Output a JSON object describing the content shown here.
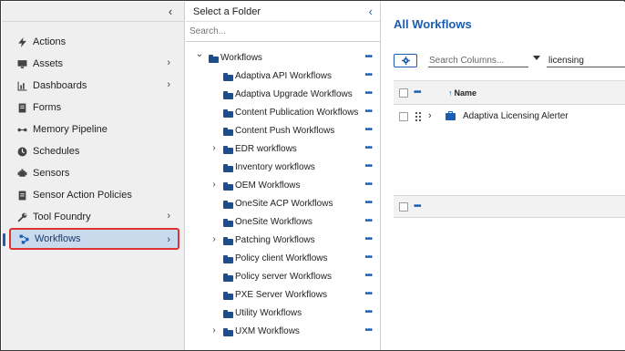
{
  "nav": {
    "items": [
      {
        "label": "Actions",
        "icon": "lightning-icon",
        "chevron": false
      },
      {
        "label": "Assets",
        "icon": "monitor-icon",
        "chevron": true
      },
      {
        "label": "Dashboards",
        "icon": "bar-chart-icon",
        "chevron": true
      },
      {
        "label": "Forms",
        "icon": "form-icon",
        "chevron": false
      },
      {
        "label": "Memory Pipeline",
        "icon": "pipeline-icon",
        "chevron": false
      },
      {
        "label": "Schedules",
        "icon": "clock-icon",
        "chevron": false
      },
      {
        "label": "Sensors",
        "icon": "sensor-icon",
        "chevron": false
      },
      {
        "label": "Sensor Action Policies",
        "icon": "policy-icon",
        "chevron": false
      },
      {
        "label": "Tool Foundry",
        "icon": "wrench-icon",
        "chevron": true
      },
      {
        "label": "Workflows",
        "icon": "workflow-icon",
        "chevron": true,
        "selected": true
      }
    ]
  },
  "folders": {
    "title": "Select a Folder",
    "search_placeholder": "Search...",
    "root": {
      "label": "Workflows",
      "expanded": true
    },
    "items": [
      {
        "label": "Adaptiva API Workflows",
        "expandable": false
      },
      {
        "label": "Adaptiva Upgrade Workflows",
        "expandable": false
      },
      {
        "label": "Content Publication Workflows",
        "expandable": false
      },
      {
        "label": "Content Push Workflows",
        "expandable": false
      },
      {
        "label": "EDR workflows",
        "expandable": true
      },
      {
        "label": "Inventory workflows",
        "expandable": false
      },
      {
        "label": "OEM Workflows",
        "expandable": true
      },
      {
        "label": "OneSite ACP Workflows",
        "expandable": false
      },
      {
        "label": "OneSite Workflows",
        "expandable": false
      },
      {
        "label": "Patching Workflows",
        "expandable": true
      },
      {
        "label": "Policy client Workflows",
        "expandable": false
      },
      {
        "label": "Policy server Workflows",
        "expandable": false
      },
      {
        "label": "PXE Server Workflows",
        "expandable": false
      },
      {
        "label": "Utility Workflows",
        "expandable": false
      },
      {
        "label": "UXM Workflows",
        "expandable": true
      }
    ]
  },
  "main": {
    "title": "All Workflows",
    "column_search_placeholder": "Search Columns...",
    "filter_value": "licensing",
    "grid": {
      "column_name": "Name",
      "rows": [
        {
          "name": "Adaptiva Licensing Alerter"
        }
      ]
    }
  },
  "colors": {
    "accent": "#1a5cb0",
    "selected_bg": "#c9daec",
    "highlight_border": "#dd3333"
  }
}
